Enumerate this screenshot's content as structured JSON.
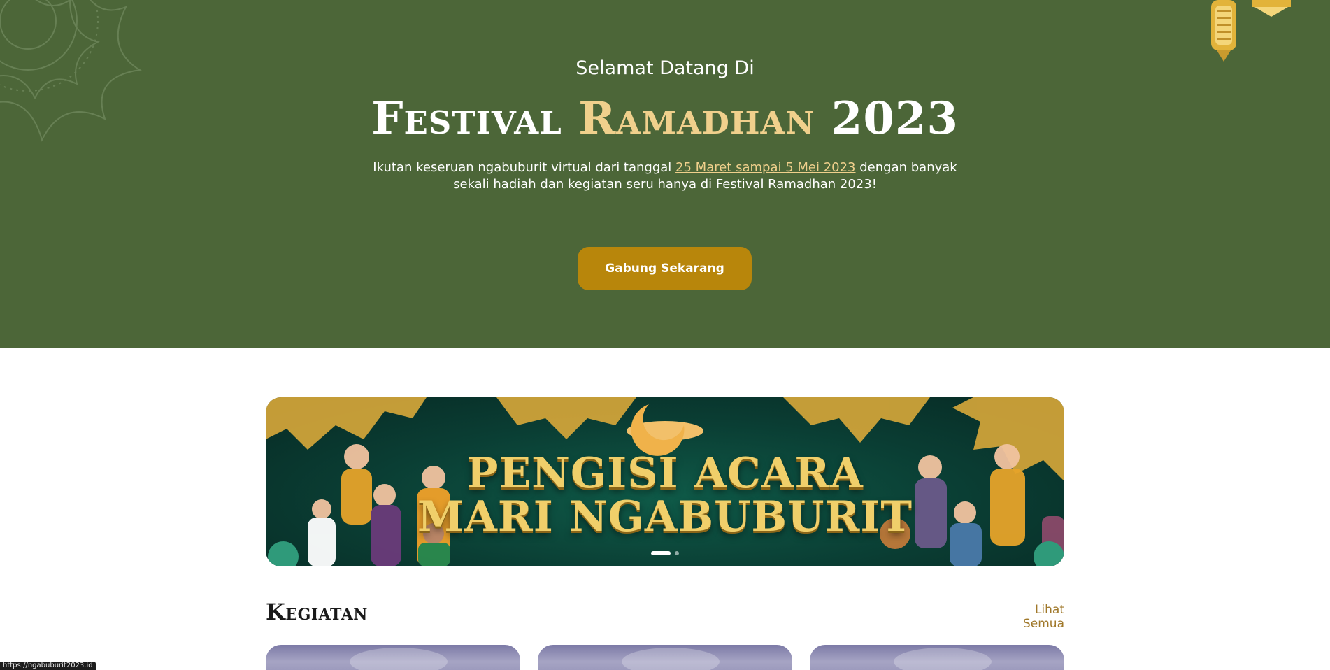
{
  "hero": {
    "subtitle": "Selamat Datang Di",
    "title_part1": "Festival",
    "title_part2": "Ramadhan",
    "title_part3": "2023",
    "desc_before": "Ikutan keseruan ngabuburit virtual dari tanggal ",
    "desc_link": "25 Maret sampai 5 Mei 2023",
    "desc_after": " dengan banyak sekali hadiah dan kegiatan seru hanya di Festival Ramadhan 2023!",
    "cta_label": "Gabung Sekarang",
    "background_color": "#4c6638",
    "accent_color": "#f0d08c",
    "cta_color": "#b8860b"
  },
  "banner": {
    "text_line1": "PENGISI ACARA",
    "text_line2": "MARI NGABUBURIT",
    "slides_count": 2,
    "active_slide": 1
  },
  "kegiatan": {
    "title": "Kegiatan",
    "see_all": "Lihat Semua",
    "cards_visible": 3
  },
  "status_bar": {
    "url": "https://ngabuburit2023.id"
  }
}
